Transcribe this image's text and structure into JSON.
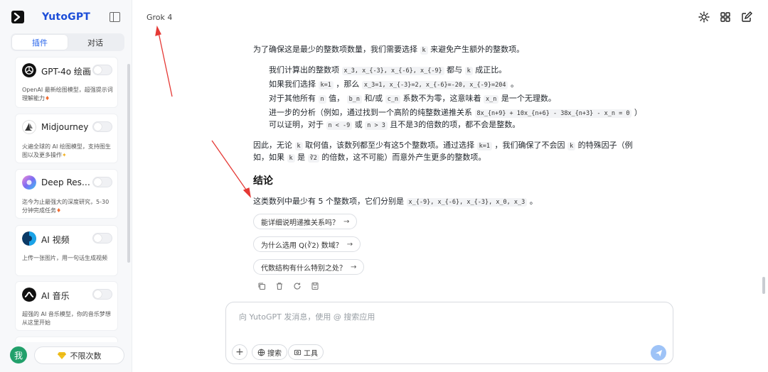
{
  "app": {
    "brand": "YutoGPT",
    "model": "Grok 4"
  },
  "sidebar": {
    "tabs": [
      {
        "label": "插件",
        "active": true
      },
      {
        "label": "对话",
        "active": false
      }
    ],
    "plugins": [
      {
        "name": "GPT-4o 绘画",
        "desc": "OpenAI 最新绘图模型，超强提示词理解能力",
        "icon": "openai-icon",
        "color": "#111111"
      },
      {
        "name": "Midjourney",
        "desc": "火遍全球的 AI 绘图模型，支持图生图以及更多操作",
        "icon": "midjourney-icon",
        "color": "#ffffff"
      },
      {
        "name": "Deep Research",
        "desc": "迄今为止最强大的深度研究，5-30分钟完成任务",
        "icon": "deep-research-icon",
        "color": "#7c6cf2"
      },
      {
        "name": "AI 视频",
        "desc": "上传一张图片，用一句话生成视频",
        "icon": "ai-video-icon",
        "color": "#0b3a66"
      },
      {
        "name": "AI 音乐",
        "desc": "超强的 AI 音乐模型，你的音乐梦想从这里开始",
        "icon": "ai-music-icon",
        "color": "#111111"
      }
    ],
    "user_avatar": "我",
    "unlimited_label": "不限次数"
  },
  "content": {
    "lines": [
      {
        "kind": "p",
        "text": "为了确保这是最少的整数项数量，我们需要选择 k 来避免产生额外的整数项。"
      },
      {
        "kind": "li",
        "text": "我们计算出的整数项 x_3, x_{-3}, x_{-6}, x_{-9} 都与 k 成正比。"
      },
      {
        "kind": "li",
        "text": "如果我们选择 k=1 ，那么 x_3=1, x_{-3}=2, x_{-6}=-20, x_{-9}=204 。"
      },
      {
        "kind": "li",
        "text": "对于其他所有 n 值， b_n 和/或 c_n 系数不为零，这意味着 x_n 是一个无理数。"
      },
      {
        "kind": "li",
        "text": "进一步的分析（例如，通过找到一个高阶的纯整数递推关系 8x_{n+9} + 10x_{n+6} - 38x_{n+3} - x_n = 0 ）"
      },
      {
        "kind": "li",
        "text": "可以证明，对于 n < -9 或 n > 3 且不是3的倍数的项，都不会是整数。"
      },
      {
        "kind": "p",
        "text": "因此，无论 k 取何值，该数列都至少有这5个整数项。通过选择 k=1 ，我们确保了不会因 k 的特殊因子（例"
      },
      {
        "kind": "p",
        "text": "如，如果 k 是 ∛2 的倍数，这不可能）而意外产生更多的整数项。"
      }
    ],
    "heading": "结论",
    "conclusion": "这类数列中最少有 5 个整数项，它们分别是 x_{-9}, x_{-6}, x_{-3}, x_0, x_3 。",
    "suggestions": [
      "能详细说明递推关系吗？",
      "为什么选用 Q(∛2) 数域？",
      "代数结构有什么特别之处？"
    ],
    "arrow": "→"
  },
  "composer": {
    "placeholder": "向 YutoGPT 发消息，使用 @ 搜索应用",
    "search_label": "搜索",
    "tools_label": "工具",
    "plus": "+"
  },
  "colors": {
    "brand": "#1d4ed8",
    "accent": "#2563eb",
    "annotation": "#e53935"
  }
}
